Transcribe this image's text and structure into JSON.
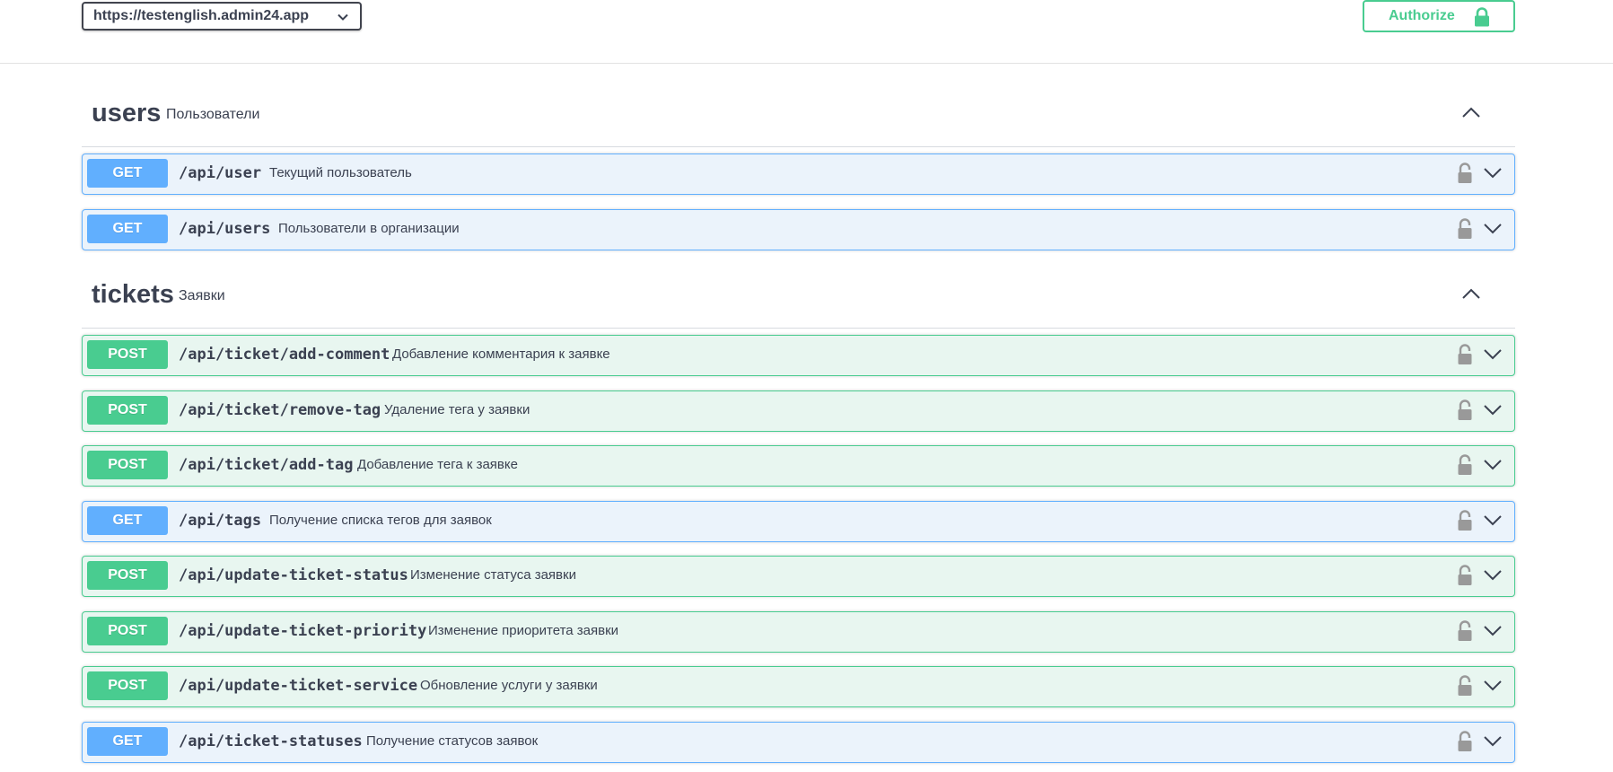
{
  "header": {
    "server_url": "https://testenglish.admin24.app",
    "authorize_label": "Authorize"
  },
  "colors": {
    "get": "#61affe",
    "post": "#49cc90",
    "get_bg": "#ebf3fb",
    "post_bg": "#e8f6f0",
    "text": "#3b4151"
  },
  "sections": [
    {
      "name": "users",
      "description": "Пользователи",
      "operations": [
        {
          "method": "GET",
          "path": "/api/user",
          "summary": "Текущий пользователь"
        },
        {
          "method": "GET",
          "path": "/api/users",
          "summary": "Пользователи в организации"
        }
      ]
    },
    {
      "name": "tickets",
      "description": "Заявки",
      "operations": [
        {
          "method": "POST",
          "path": "/api/ticket/add-comment",
          "summary": "Добавление комментария к заявке"
        },
        {
          "method": "POST",
          "path": "/api/ticket/remove-tag",
          "summary": "Удаление тега у заявки"
        },
        {
          "method": "POST",
          "path": "/api/ticket/add-tag",
          "summary": "Добавление тега к заявке"
        },
        {
          "method": "GET",
          "path": "/api/tags",
          "summary": "Получение списка тегов для заявок"
        },
        {
          "method": "POST",
          "path": "/api/update-ticket-status",
          "summary": "Изменение статуса заявки"
        },
        {
          "method": "POST",
          "path": "/api/update-ticket-priority",
          "summary": "Изменение приоритета заявки"
        },
        {
          "method": "POST",
          "path": "/api/update-ticket-service",
          "summary": "Обновление услуги у заявки"
        },
        {
          "method": "GET",
          "path": "/api/ticket-statuses",
          "summary": "Получение статусов заявок"
        }
      ]
    }
  ],
  "icons": [
    "chevron-down-icon",
    "lock-icon",
    "chevron-up-icon",
    "unlock-icon"
  ]
}
